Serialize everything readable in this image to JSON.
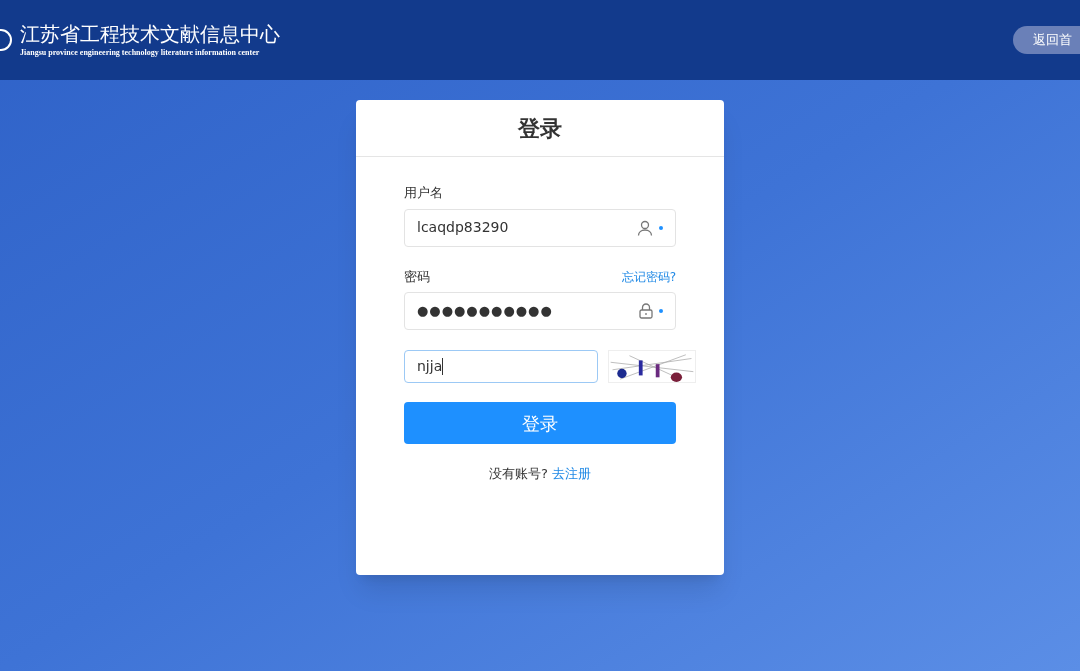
{
  "header": {
    "title": "江苏省工程技术文献信息中心",
    "subtitle": "Jiangsu province engineering technology literature information center",
    "home_button": "返回首"
  },
  "login": {
    "title": "登录",
    "username": {
      "label": "用户名",
      "value": "lcaqdp83290"
    },
    "password": {
      "label": "密码",
      "forgot_link": "忘记密码?",
      "value": "●●●●●●●●●●●"
    },
    "captcha": {
      "value": "njja",
      "focused": true
    },
    "submit": "登录",
    "register_prompt": "没有账号?",
    "register_link": "去注册"
  }
}
